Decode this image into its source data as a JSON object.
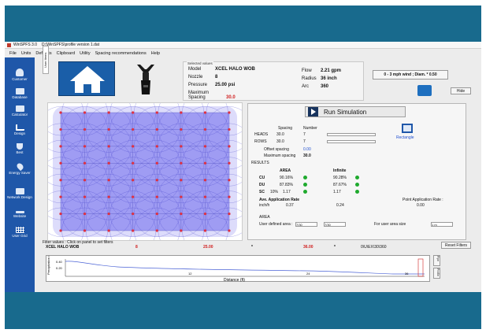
{
  "window": {
    "app_title": "WinSPFS 3.0",
    "file_path": "D:\\WinSPFS\\profile version 1.dat"
  },
  "menu": [
    "File",
    "Units",
    "Defaults",
    "Clipboard",
    "Utility",
    "Spacing recommendations",
    "Help"
  ],
  "sidebar": {
    "items": [
      {
        "label": "Customer",
        "icon": "person-icon"
      },
      {
        "label": "Database",
        "icon": "database-icon"
      },
      {
        "label": "Calculator",
        "icon": "calculator-icon"
      },
      {
        "label": "Design",
        "icon": "design-icon"
      },
      {
        "label": "Best",
        "icon": "trophy-icon"
      },
      {
        "label": "Energy Saver",
        "icon": "energy-icon"
      },
      {
        "label": "Network Design",
        "icon": "network-icon"
      },
      {
        "label": "Website",
        "icon": "web-icon"
      },
      {
        "label": "User Grid",
        "icon": "grid-icon"
      }
    ]
  },
  "tabs": {
    "vertical": "User Items"
  },
  "selected": {
    "label": "Selected values",
    "model_key": "Model",
    "model_val": "XCEL HALO WOB",
    "nozzle_key": "Nozzle",
    "nozzle_val": "8",
    "pressure_key": "Pressure",
    "pressure_val": "25.00 psi",
    "maxspacing_key": "Maximum Spacing",
    "maxspacing_val": "30.0",
    "flow_key": "Flow",
    "flow_val": "2.21 gpm",
    "radius_key": "Radius",
    "radius_val": "36 inch",
    "arc_key": "Arc",
    "arc_val": "360"
  },
  "wind_button": "0 - 3 mph wind ; Diam. * 0.50",
  "hide_button": "Hide",
  "run": {
    "label": "Run Simulation"
  },
  "spacing": {
    "col_spacing": "Spacing",
    "col_number": "Number",
    "heads_label": "HEADS",
    "heads_spacing": "30.0",
    "heads_number": "7",
    "rows_label": "ROWS",
    "rows_spacing": "30.0",
    "rows_number": "7",
    "offset_label": "Offset spacing",
    "offset_val": "0.00",
    "max_label": "Maximum spacing",
    "max_val": "30.0",
    "shape_label": "Rectangle"
  },
  "results": {
    "label": "RESULTS",
    "area_header": "AREA",
    "infinite_header": "Infinite",
    "cu_label": "CU",
    "cu_area": "90.16%",
    "cu_inf": "90.28%",
    "du_label": "DU",
    "du_area": "87.83%",
    "du_inf": "87.67%",
    "sc_label": "SC",
    "sc_pct": "10%",
    "sc_area": "1.17",
    "sc_inf": "1.17",
    "app_rate_label": "Ave. Application Rate",
    "app_rate_unit": "inch/h",
    "app_rate_area": "0.37",
    "app_rate_inf": "0.24",
    "point_label": "Point Application Rate :",
    "point_val": "0.00",
    "area2_label": "AREA",
    "user_area_label": "User defined area :",
    "user_area_w": "7/30",
    "user_area_h": "7/30",
    "zoom_label": "For user area size",
    "zoom_val": "1 m"
  },
  "filter": {
    "hint": "Filter values : Click on panel to set filters",
    "model": "XCEL HALO WOB",
    "nozzle": "8",
    "pressure": "25.00",
    "dash1": "*",
    "spacing": "36.00",
    "dash2": "*",
    "code": "0\\U\\EX\\30\\360",
    "reset": "Reset Filters"
  },
  "profile": {
    "y_label": "Precipitation inch/h",
    "y_ticks": [
      "0.40",
      "0.20"
    ],
    "x_label": "Distance (ft)",
    "x_ticks": [
      "12",
      "24",
      "36"
    ],
    "side_buttons": [
      "Pipe",
      "Profile"
    ]
  }
}
